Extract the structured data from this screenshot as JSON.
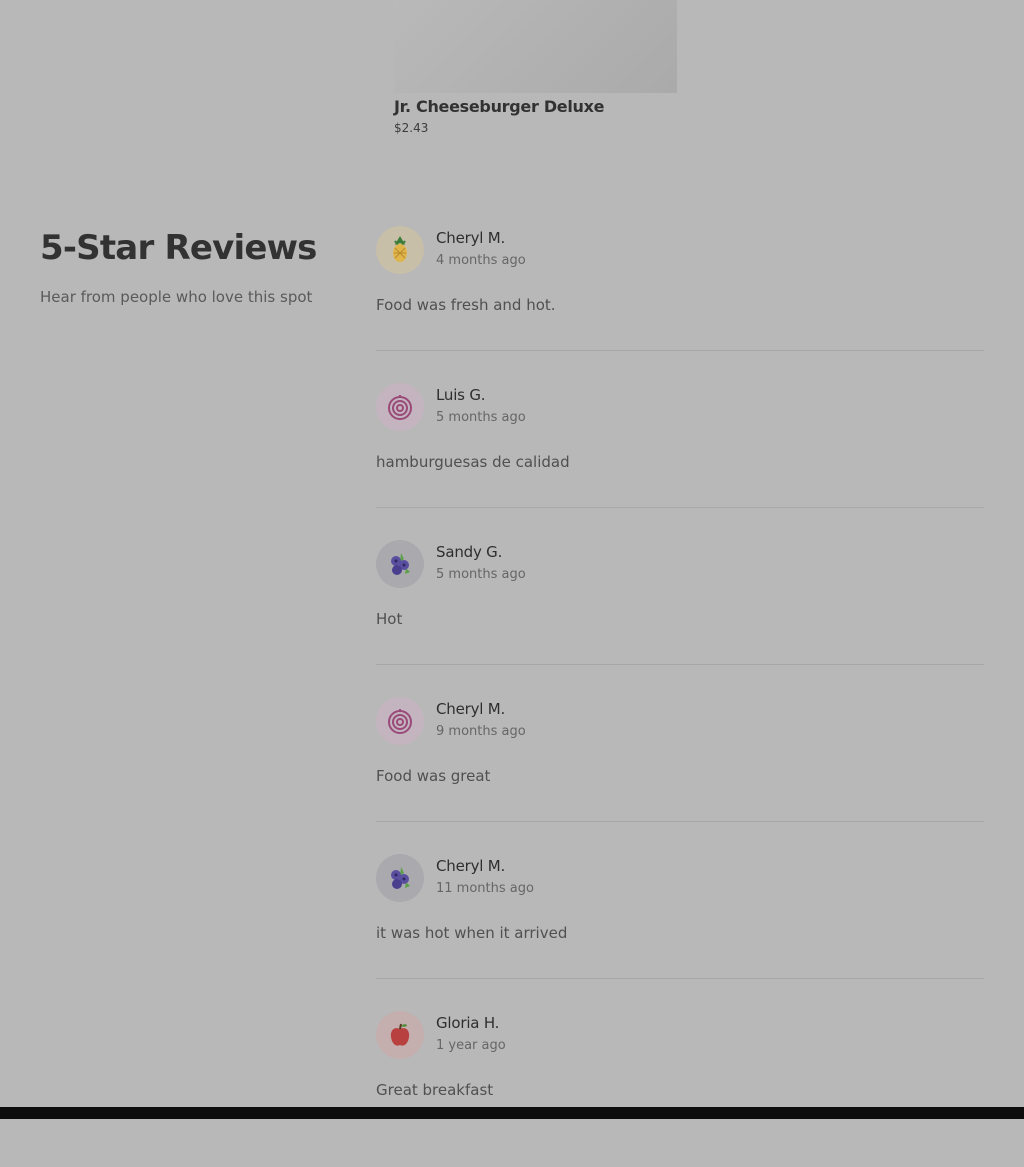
{
  "menu_item": {
    "name": "Jr. Cheeseburger Deluxe",
    "price": "$2.43"
  },
  "reviews_section": {
    "title": "5-Star Reviews",
    "subtitle": "Hear from people who love this spot"
  },
  "reviews": [
    {
      "name": "Cheryl M.",
      "time": "4 months ago",
      "text": "Food was fresh and hot.",
      "avatar_icon": "pineapple-icon",
      "avatar_bg": "#c8bfa8"
    },
    {
      "name": "Luis G.",
      "time": "5 months ago",
      "text": "hamburguesas de calidad",
      "avatar_icon": "onion-icon",
      "avatar_bg": "#c4b4bf"
    },
    {
      "name": "Sandy G.",
      "time": "5 months ago",
      "text": "Hot",
      "avatar_icon": "blueberries-icon",
      "avatar_bg": "#a9a9ae"
    },
    {
      "name": "Cheryl M.",
      "time": "9 months ago",
      "text": "Food was great",
      "avatar_icon": "onion-icon",
      "avatar_bg": "#c4b4bf"
    },
    {
      "name": "Cheryl M.",
      "time": "11 months ago",
      "text": "it was hot when it arrived",
      "avatar_icon": "blueberries-icon",
      "avatar_bg": "#a9a9ae"
    },
    {
      "name": "Gloria H.",
      "time": "1 year ago",
      "text": "Great breakfast",
      "avatar_icon": "apple-icon",
      "avatar_bg": "#c4aeae"
    }
  ]
}
